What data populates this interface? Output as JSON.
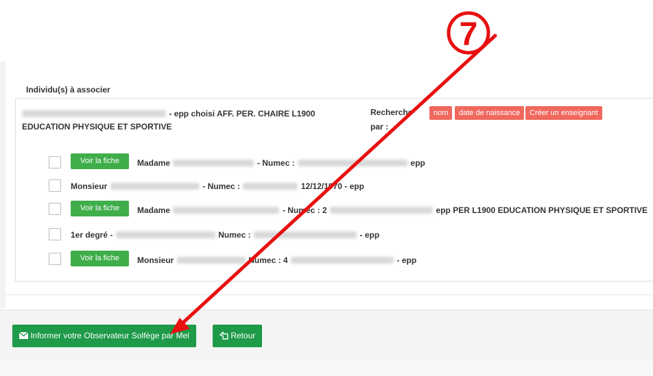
{
  "section_title": "Individu(s) à associer",
  "header_row": {
    "line1": "- epp choisi AFF. PER. CHAIRE L1900",
    "line2": "EDUCATION PHYSIQUE ET SPORTIVE",
    "search_label_1": "Recherche",
    "search_label_2": "par :",
    "buttons": [
      "nom",
      "date de naissance",
      "Créer un enseignant"
    ]
  },
  "rows": [
    {
      "button": "Voir la fiche",
      "title": "Madame",
      "numec": "- Numec :",
      "tail": "epp"
    },
    {
      "title": "Monsieur",
      "numec": "- Numec :",
      "tail": "12/12/1970 - epp"
    },
    {
      "button": "Voir la fiche",
      "title": "Madame",
      "numec": "- Numec : 2",
      "tail": "epp PER L1900 EDUCATION PHYSIQUE ET SPORTIVE"
    },
    {
      "title": "1er degré -",
      "numec": "Numec :",
      "tail": "- epp"
    },
    {
      "button": "Voir la fiche",
      "title": "Monsieur",
      "numec": "Numec : 4",
      "tail": "- epp"
    }
  ],
  "footer": {
    "inform_label": "Informer votre Observateur Solfège par Mel",
    "back_label": "Retour"
  },
  "annotation": {
    "number": "7",
    "color": "#e81010"
  },
  "colors": {
    "green": "#1e9a48",
    "green_light": "#3fae4a",
    "red_button": "#f0685e"
  }
}
